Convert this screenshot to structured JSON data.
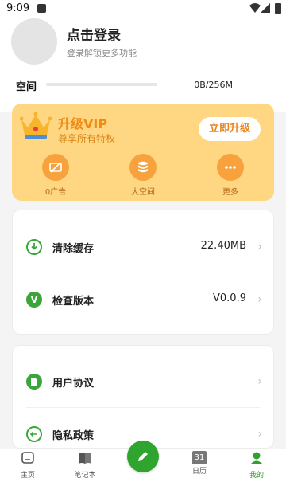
{
  "status_bar": {
    "time": "9:09"
  },
  "profile": {
    "login_title": "点击登录",
    "login_subtitle": "登录解锁更多功能"
  },
  "storage": {
    "label": "空间",
    "value": "0B/256M",
    "used_fraction": 0
  },
  "vip": {
    "title": "升级VIP",
    "subtitle": "尊享所有特权",
    "upgrade_button": "立即升级",
    "features": [
      {
        "label": "0广告",
        "icon": "no-ads-icon"
      },
      {
        "label": "大空间",
        "icon": "storage-icon"
      },
      {
        "label": "更多",
        "icon": "more-icon"
      }
    ]
  },
  "settings": {
    "clear_cache": {
      "label": "清除缓存",
      "value": "22.40MB",
      "icon": "download-circle-icon"
    },
    "check_version": {
      "label": "检查版本",
      "value": "V0.0.9",
      "icon": "v-badge-icon"
    },
    "user_agreement": {
      "label": "用户协议",
      "icon": "document-icon"
    },
    "privacy_policy": {
      "label": "隐私政策",
      "icon": "exit-circle-icon"
    }
  },
  "colors": {
    "accent_green": "#2fa52f",
    "vip_bg": "#ffd782",
    "vip_orange": "#f7a23c"
  },
  "tabbar": {
    "items": [
      {
        "label": "主页",
        "icon": "home-icon"
      },
      {
        "label": "笔记本",
        "icon": "book-icon"
      },
      {
        "label": "",
        "icon": "pen-icon"
      },
      {
        "label": "日历",
        "icon": "calendar-icon",
        "badge": "31"
      },
      {
        "label": "我的",
        "icon": "user-icon"
      }
    ]
  }
}
